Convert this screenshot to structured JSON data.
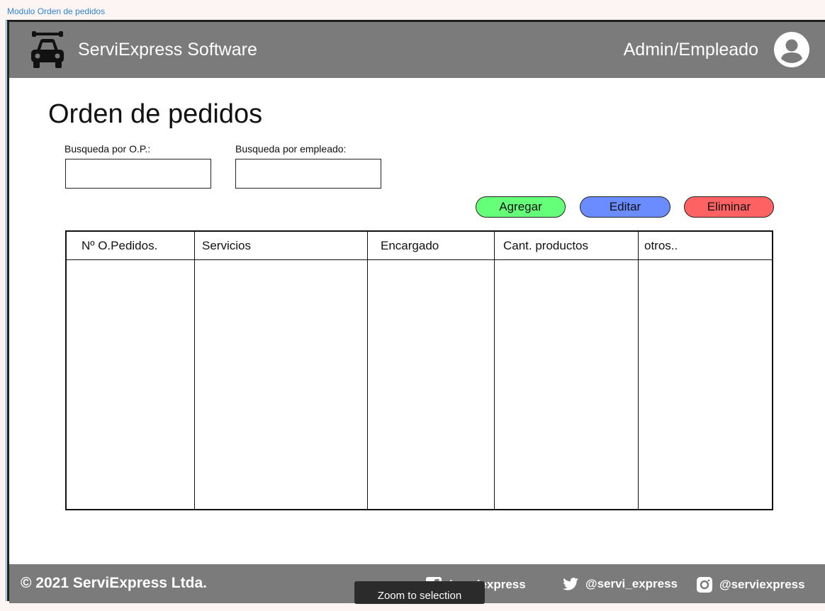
{
  "frame_label": "Modulo Orden de pedidos",
  "header": {
    "app_title": "ServiExpress Software",
    "user_role": "Admin/Empleado"
  },
  "page_title": "Orden de pedidos",
  "search": {
    "op_label": "Busqueda por O.P.:",
    "op_value": "",
    "employee_label": "Busqueda por empleado:",
    "employee_value": ""
  },
  "actions": {
    "add_label": "Agregar",
    "edit_label": "Editar",
    "delete_label": "Eliminar",
    "add_color": "#66ff7a",
    "edit_color": "#6a8cff",
    "delete_color": "#ff6262"
  },
  "table": {
    "columns": [
      "Nº O.Pedidos.",
      "Servicios",
      "Encargado",
      "Cant. productos",
      "otros.."
    ],
    "rows": []
  },
  "footer": {
    "copyright": "© 2021 ServiExpress Ltda.",
    "facebook": "/serviexpress",
    "twitter": "@servi_express",
    "instagram": "@serviexpress"
  },
  "tooltip": "Zoom to selection",
  "colors": {
    "bar": "#7b7b7b",
    "selection": "#3f92df"
  }
}
